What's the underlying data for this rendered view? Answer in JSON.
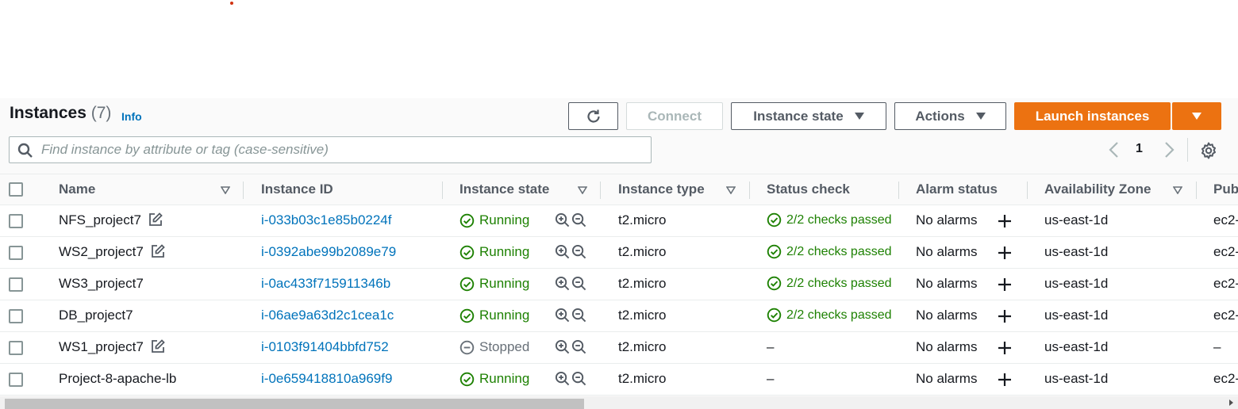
{
  "header": {
    "title": "Instances",
    "count": "(7)",
    "info": "Info",
    "connect_label": "Connect",
    "instance_state_label": "Instance state",
    "actions_label": "Actions",
    "launch_label": "Launch instances"
  },
  "search": {
    "placeholder": "Find instance by attribute or tag (case-sensitive)",
    "value": ""
  },
  "pagination": {
    "current_page": "1"
  },
  "columns": {
    "name": "Name",
    "instance_id": "Instance ID",
    "instance_state": "Instance state",
    "instance_type": "Instance type",
    "status_check": "Status check",
    "alarm_status": "Alarm status",
    "availability_zone": "Availability Zone",
    "public": "Pub"
  },
  "rows": [
    {
      "name": "NFS_project7",
      "editable": true,
      "id": "i-033b03c1e85b0224f",
      "state": "Running",
      "type": "t2.micro",
      "status": "2/2 checks passed",
      "alarm": "No alarms",
      "az": "us-east-1d",
      "public": "ec2-"
    },
    {
      "name": "WS2_project7",
      "editable": true,
      "id": "i-0392abe99b2089e79",
      "state": "Running",
      "type": "t2.micro",
      "status": "2/2 checks passed",
      "alarm": "No alarms",
      "az": "us-east-1d",
      "public": "ec2-"
    },
    {
      "name": "WS3_project7",
      "editable": false,
      "id": "i-0ac433f715911346b",
      "state": "Running",
      "type": "t2.micro",
      "status": "2/2 checks passed",
      "alarm": "No alarms",
      "az": "us-east-1d",
      "public": "ec2-"
    },
    {
      "name": "DB_project7",
      "editable": false,
      "id": "i-06ae9a63d2c1cea1c",
      "state": "Running",
      "type": "t2.micro",
      "status": "2/2 checks passed",
      "alarm": "No alarms",
      "az": "us-east-1d",
      "public": "ec2-"
    },
    {
      "name": "WS1_project7",
      "editable": true,
      "id": "i-0103f91404bbfd752",
      "state": "Stopped",
      "type": "t2.micro",
      "status": "–",
      "alarm": "No alarms",
      "az": "us-east-1d",
      "public": "–"
    },
    {
      "name": "Project-8-apache-lb",
      "editable": false,
      "id": "i-0e659418810a969f9",
      "state": "Running",
      "type": "t2.micro",
      "status": "–",
      "alarm": "No alarms",
      "az": "us-east-1d",
      "public": "ec2-"
    }
  ],
  "colors": {
    "accent": "#ec7211",
    "link": "#0073bb",
    "running": "#1d8102",
    "stopped": "#687078"
  },
  "icons": {
    "refresh": "refresh-icon",
    "search": "search-icon",
    "settings": "gear-icon",
    "running": "check-circle-icon",
    "stopped": "stopped-circle-icon",
    "zoom_in": "zoom-in-icon",
    "zoom_out": "zoom-out-icon",
    "edit": "edit-icon",
    "add_alarm": "plus-icon"
  }
}
